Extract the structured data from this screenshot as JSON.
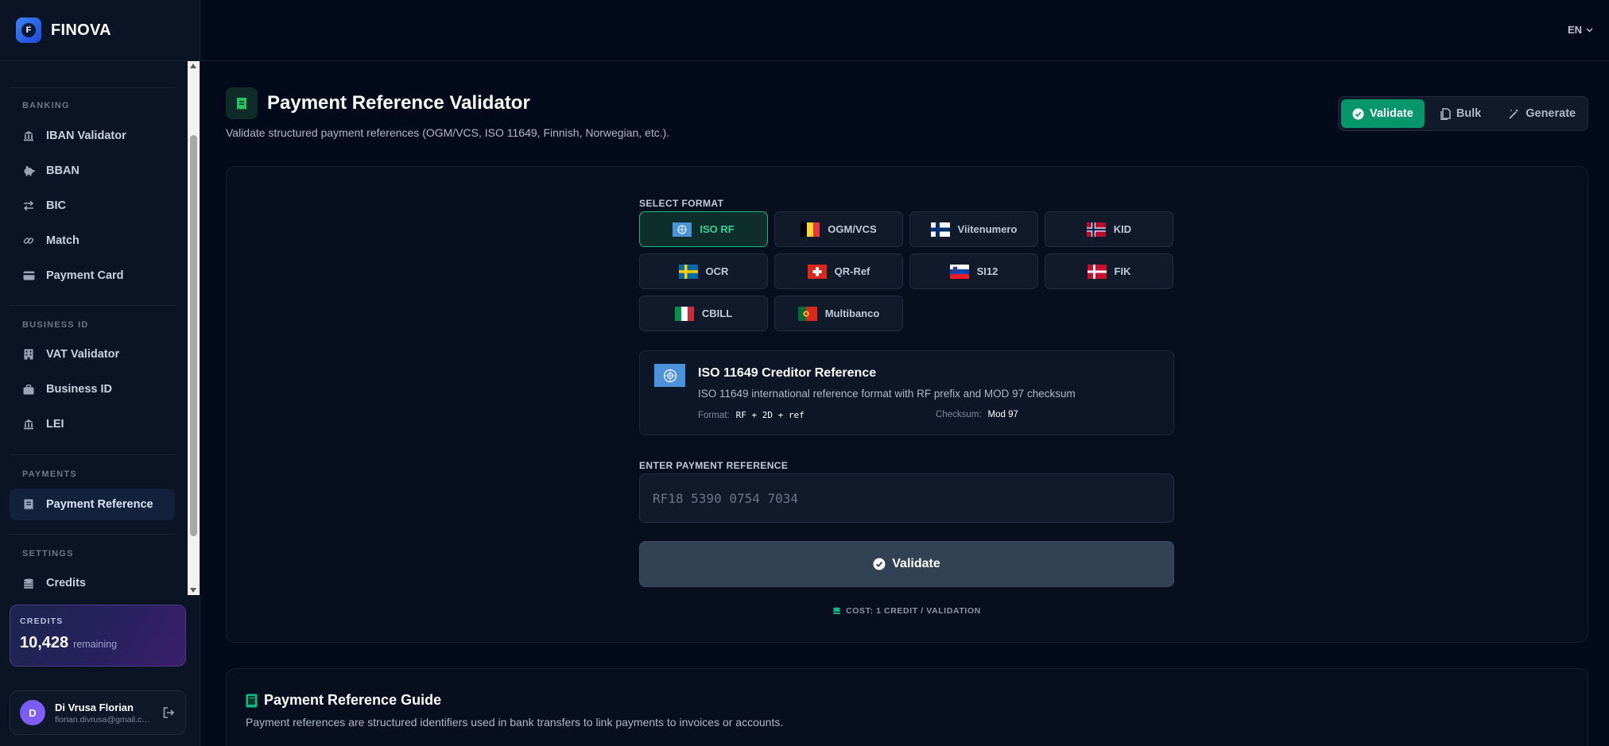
{
  "app": {
    "name": "FINOVA",
    "logo_letter": "F"
  },
  "topbar": {
    "language": "EN"
  },
  "sidebar": {
    "sections": [
      {
        "label": "BANKING",
        "items": [
          {
            "label": "IBAN Validator",
            "icon": "bank-icon"
          },
          {
            "label": "BBAN",
            "icon": "piggy-bank-icon"
          },
          {
            "label": "BIC",
            "icon": "transfer-arrows-icon"
          },
          {
            "label": "Match",
            "icon": "link-icon"
          },
          {
            "label": "Payment Card",
            "icon": "credit-card-icon"
          }
        ]
      },
      {
        "label": "BUSINESS ID",
        "items": [
          {
            "label": "VAT Validator",
            "icon": "building-icon"
          },
          {
            "label": "Business ID",
            "icon": "briefcase-icon"
          },
          {
            "label": "LEI",
            "icon": "bank-icon"
          }
        ]
      },
      {
        "label": "PAYMENTS",
        "items": [
          {
            "label": "Payment Reference",
            "icon": "receipt-icon",
            "active": true
          }
        ]
      },
      {
        "label": "SETTINGS",
        "items": [
          {
            "label": "Credits",
            "icon": "coins-icon"
          }
        ]
      }
    ],
    "credits": {
      "label": "CREDITS",
      "value": "10,428",
      "suffix": "remaining"
    },
    "user": {
      "initial": "D",
      "name": "Di Vrusa Florian",
      "email": "florian.divrusa@gmail.co..."
    }
  },
  "header": {
    "title": "Payment Reference Validator",
    "subtitle": "Validate structured payment references (OGM/VCS, ISO 11649, Finnish, Norwegian, etc.).",
    "modes": [
      {
        "label": "Validate",
        "active": true
      },
      {
        "label": "Bulk"
      },
      {
        "label": "Generate"
      }
    ]
  },
  "form": {
    "select_label": "SELECT FORMAT",
    "formats": [
      {
        "label": "ISO RF",
        "flag": "un",
        "active": true
      },
      {
        "label": "OGM/VCS",
        "flag": "be"
      },
      {
        "label": "Viitenumero",
        "flag": "fi"
      },
      {
        "label": "KID",
        "flag": "no"
      },
      {
        "label": "OCR",
        "flag": "se"
      },
      {
        "label": "QR-Ref",
        "flag": "ch"
      },
      {
        "label": "SI12",
        "flag": "si"
      },
      {
        "label": "FIK",
        "flag": "dk"
      },
      {
        "label": "CBILL",
        "flag": "it"
      },
      {
        "label": "Multibanco",
        "flag": "pt"
      }
    ],
    "info": {
      "title": "ISO 11649 Creditor Reference",
      "description": "ISO 11649 international reference format with RF prefix and MOD 97 checksum",
      "format_label": "Format:",
      "format_value": "RF + 2D + ref",
      "checksum_label": "Checksum:",
      "checksum_value": "Mod 97"
    },
    "input_label": "ENTER PAYMENT REFERENCE",
    "input_placeholder": "RF18 5390 0754 7034",
    "input_value": "",
    "validate_label": "Validate",
    "cost_note": "COST: 1 CREDIT / VALIDATION"
  },
  "guide": {
    "title": "Payment Reference Guide",
    "text": "Payment references are structured identifiers used in bank transfers to link payments to invoices or accounts."
  },
  "colors": {
    "accent": "#059669",
    "background": "#030b1a",
    "sidebar": "#0b1424",
    "active_format": "#34d399"
  }
}
